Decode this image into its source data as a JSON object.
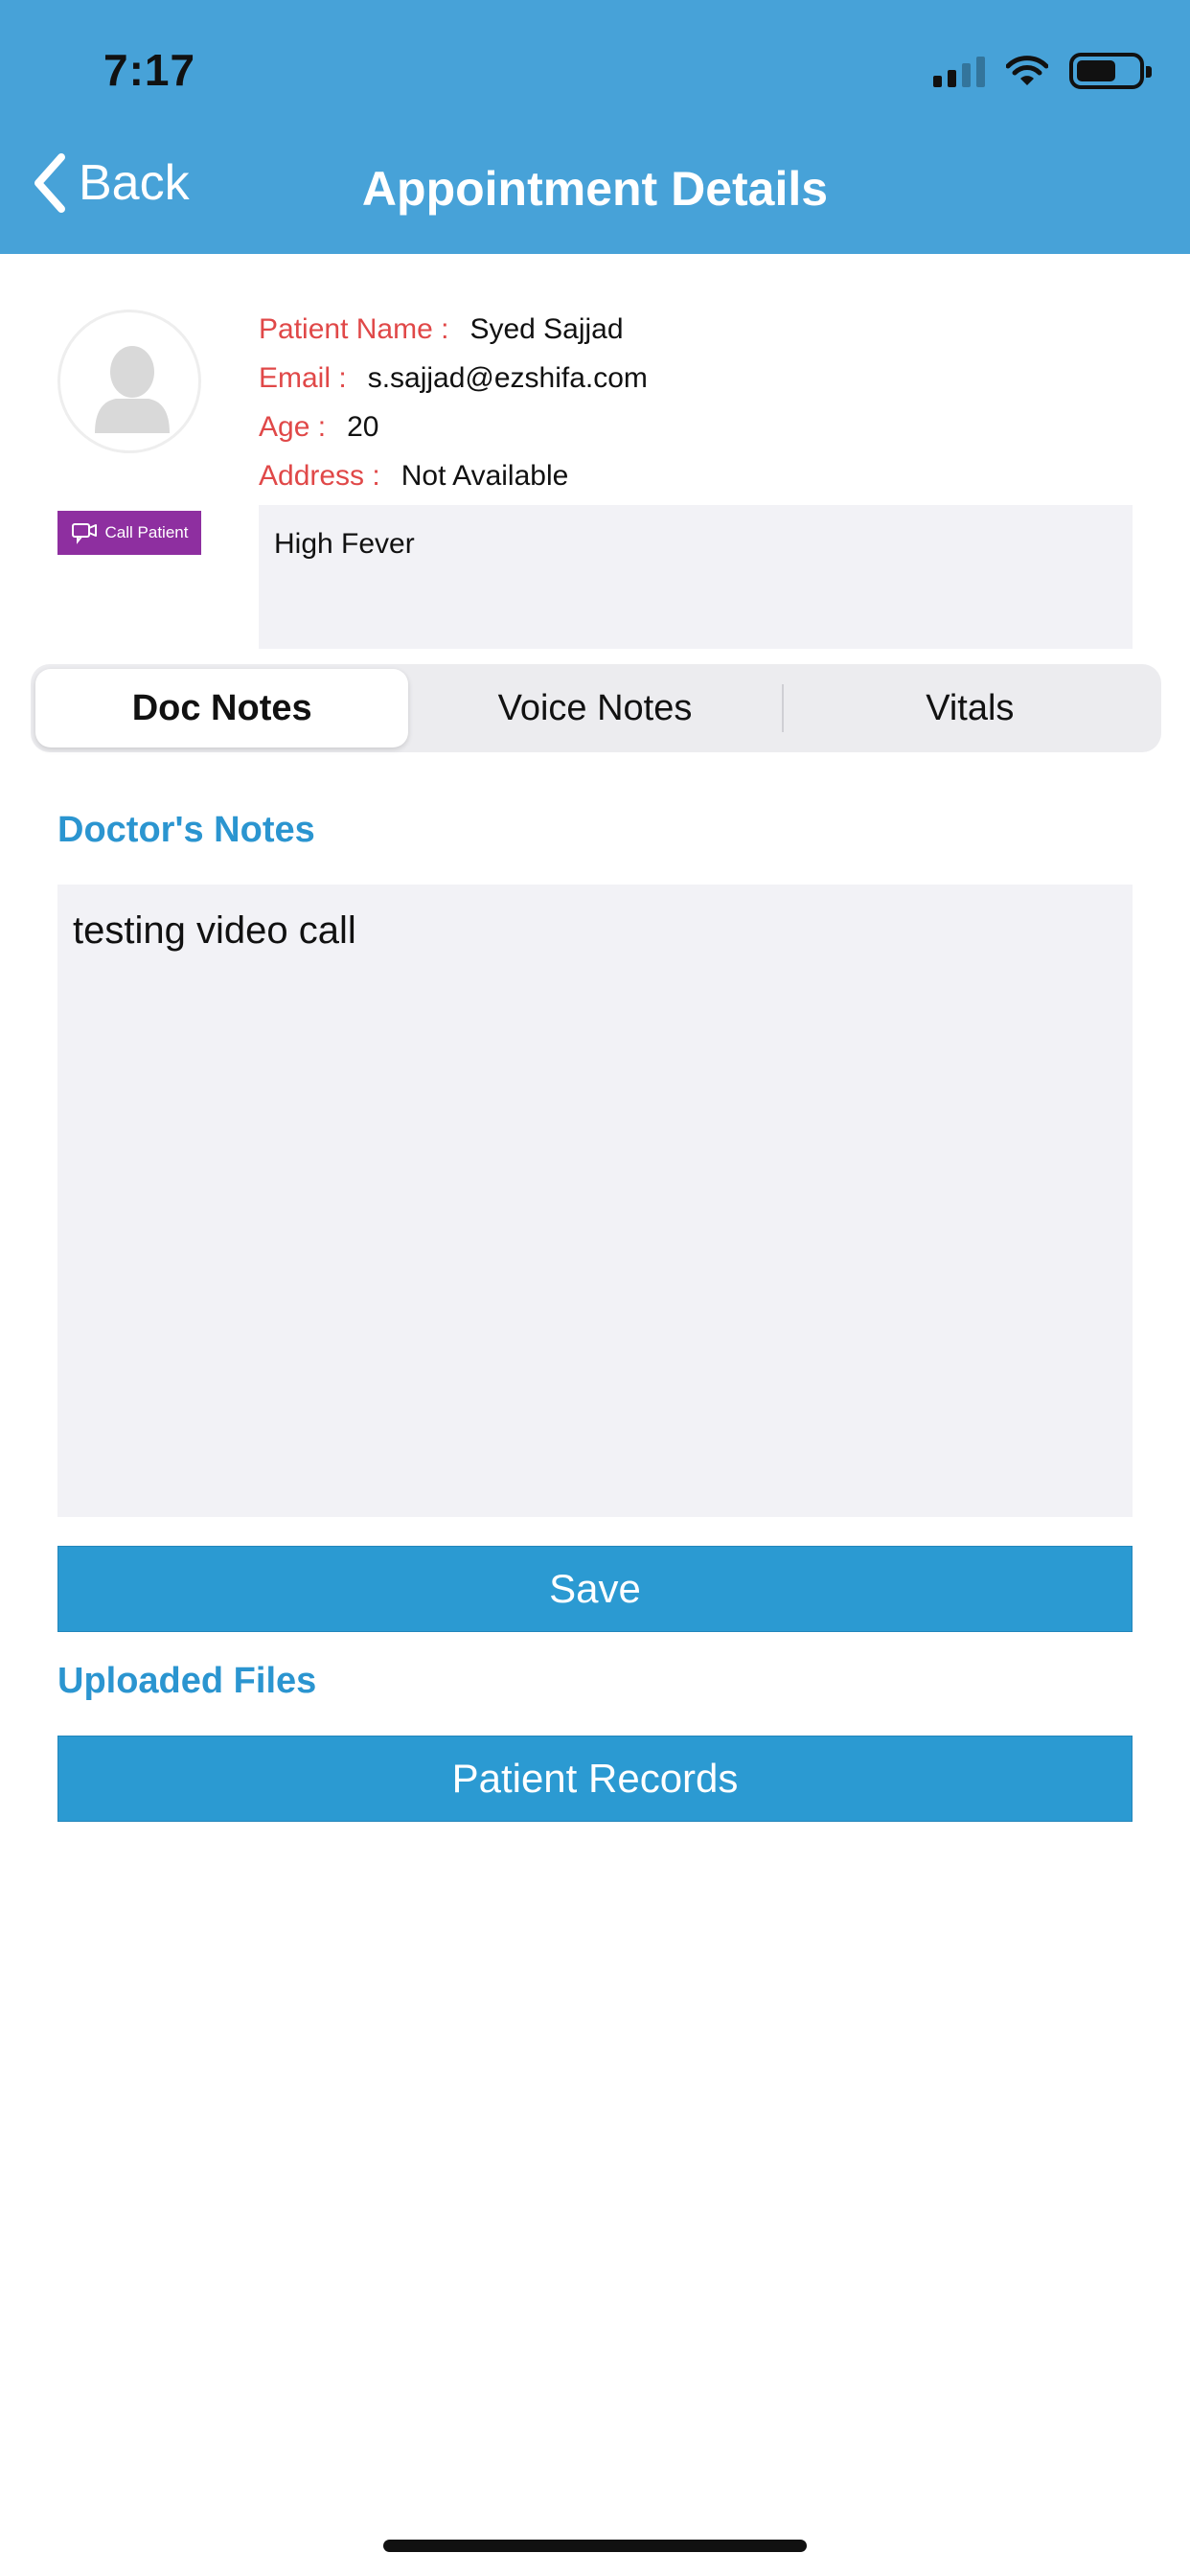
{
  "status_bar": {
    "time": "7:17"
  },
  "header": {
    "back_label": "Back",
    "title": "Appointment Details"
  },
  "patient": {
    "call_button_label": "Call Patient",
    "fields": [
      {
        "label": "Patient Name :",
        "value": "Syed Sajjad"
      },
      {
        "label": "Email :",
        "value": "s.sajjad@ezshifa.com"
      },
      {
        "label": "Age :",
        "value": "20"
      },
      {
        "label": "Address :",
        "value": "Not Available"
      }
    ],
    "complaint": "High Fever"
  },
  "tabs": [
    {
      "label": "Doc Notes",
      "active": true
    },
    {
      "label": "Voice Notes",
      "active": false
    },
    {
      "label": "Vitals",
      "active": false
    }
  ],
  "doctor_notes": {
    "heading": "Doctor's Notes",
    "text": "testing video call",
    "save_label": "Save"
  },
  "uploaded_files": {
    "heading": "Uploaded Files",
    "records_label": "Patient Records"
  },
  "colors": {
    "header_bg": "#47a2d8",
    "accent_blue": "#2b9ad2",
    "label_red": "#e04848",
    "call_purple": "#8e2fa0"
  }
}
